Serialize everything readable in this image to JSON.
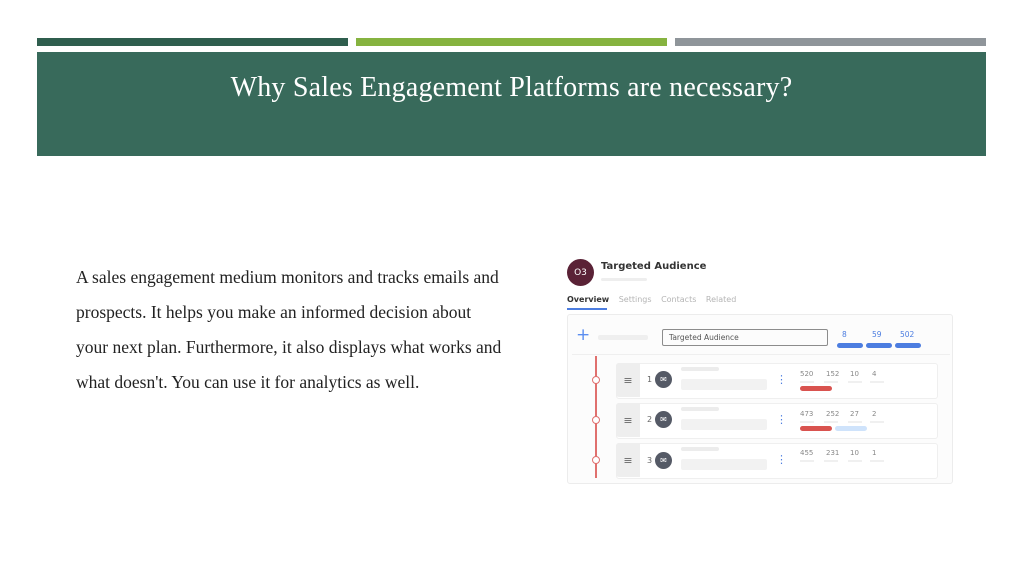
{
  "slide": {
    "title": "Why Sales Engagement Platforms are necessary?",
    "body": "A sales engagement medium monitors and tracks emails and prospects. It helps you make an informed decision about your next plan. Furthermore, it also displays what works and what doesn't. You can use it for analytics as well."
  },
  "screenshot": {
    "avatar_text": "O3",
    "title": "Targeted Audience",
    "tabs": [
      "Overview",
      "Settings",
      "Contacts",
      "Related"
    ],
    "search_value": "Targeted Audience",
    "stats": [
      "8",
      "59",
      "502"
    ],
    "steps": [
      {
        "num": "1",
        "metrics": [
          "520",
          "152",
          "10",
          "4"
        ]
      },
      {
        "num": "2",
        "metrics": [
          "473",
          "252",
          "27",
          "2"
        ]
      },
      {
        "num": "3",
        "metrics": [
          "455",
          "231",
          "10",
          "1"
        ]
      }
    ]
  },
  "colors": {
    "bar_dark_green": "#2f5e4e",
    "bar_light_green": "#86b340",
    "bar_gray": "#8f959a",
    "title_band": "#386a5b",
    "avatar": "#5a2236",
    "accent_blue": "#4c7de0",
    "timeline_red": "#d9534f"
  },
  "icons": {
    "plus": "plus-icon",
    "handle": "drag-handle-icon",
    "email": "email-icon",
    "menu": "more-vertical-icon"
  }
}
